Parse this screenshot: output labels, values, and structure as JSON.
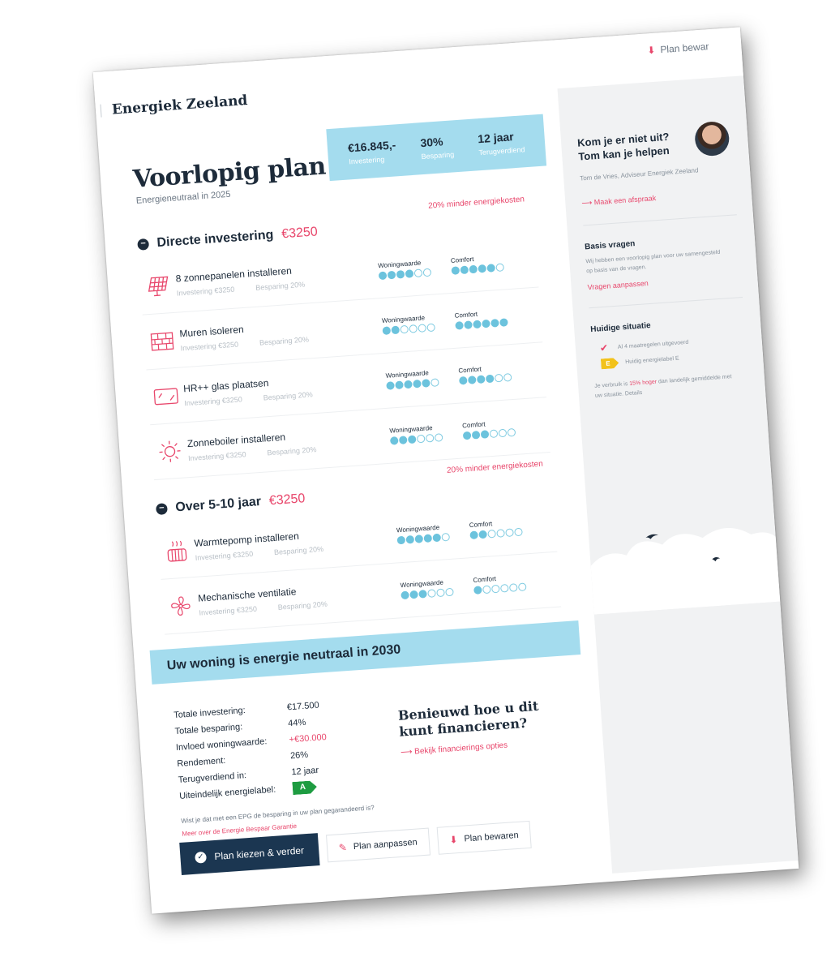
{
  "header": {
    "brand": "Energiek Zeeland",
    "save_label": "Plan bewar"
  },
  "hero": {
    "title": "Voorlopig plan",
    "subtitle": "Energieneutraal in 2025",
    "stats": [
      {
        "value": "€16.845,-",
        "label": "Investering"
      },
      {
        "value": "30%",
        "label": "Besparing"
      },
      {
        "value": "12 jaar",
        "label": "Terugverdiend"
      }
    ]
  },
  "sections": [
    {
      "note": "20% minder energiekosten",
      "title": "Directe investering",
      "amount": "€3250",
      "items": [
        {
          "name": "8 zonnepanelen installeren",
          "investment": "Investering €3250",
          "saving": "Besparing 20%",
          "icon": "solar-panel-icon",
          "woning": 4,
          "comfort": 5
        },
        {
          "name": "Muren isoleren",
          "investment": "Investering €3250",
          "saving": "Besparing 20%",
          "icon": "brick-wall-icon",
          "woning": 2,
          "comfort": 6
        },
        {
          "name": "HR++ glas plaatsen",
          "investment": "Investering €3250",
          "saving": "Besparing 20%",
          "icon": "glass-window-icon",
          "woning": 5,
          "comfort": 4
        },
        {
          "name": "Zonneboiler installeren",
          "investment": "Investering €3250",
          "saving": "Besparing 20%",
          "icon": "sun-icon",
          "woning": 3,
          "comfort": 3
        }
      ]
    },
    {
      "note": "20% minder energiekosten",
      "title": "Over 5-10 jaar",
      "amount": "€3250",
      "items": [
        {
          "name": "Warmtepomp installeren",
          "investment": "Investering €3250",
          "saving": "Besparing 20%",
          "icon": "heat-pump-icon",
          "woning": 5,
          "comfort": 2
        },
        {
          "name": "Mechanische ventilatie",
          "investment": "Investering €3250",
          "saving": "Besparing 20%",
          "icon": "fan-icon",
          "woning": 3,
          "comfort": 1
        }
      ]
    }
  ],
  "ratings": {
    "woning_label": "Woningwaarde",
    "comfort_label": "Comfort",
    "max_dots": 6
  },
  "neutral": {
    "banner": "Uw woning is energie neutraal in 2030",
    "rows": [
      {
        "key": "Totale investering:",
        "value": "€17.500"
      },
      {
        "key": "Totale besparing:",
        "value": "44%"
      },
      {
        "key": "Invloed woningwaarde:",
        "value": "+€30.000"
      },
      {
        "key": "Rendement:",
        "value": "26%"
      },
      {
        "key": "Terugverdiend in:",
        "value": "12 jaar"
      },
      {
        "key": "Uiteindelijk energielabel:",
        "value": "A"
      }
    ],
    "finance_title": "Benieuwd hoe u dit kunt financieren?",
    "finance_link": "Bekijk financierings opties",
    "epg_question": "Wist je dat met een EPG de besparing in uw plan gegarandeerd is?",
    "epg_link": "Meer over de Energie Bespaar Garantie"
  },
  "actions": {
    "primary": "Plan kiezen & verder",
    "edit": "Plan aanpassen",
    "save": "Plan bewaren"
  },
  "sidebar": {
    "advisor_question": "Kom je er niet uit? Tom kan je helpen",
    "advisor_name": "Tom de Vries, Adviseur Energiek Zeeland",
    "advisor_link": "Maak een afspraak",
    "basis_title": "Basis vragen",
    "basis_text": "Wij hebben een voorlopig plan voor uw samengesteld op basis van de vragen.",
    "basis_link": "Vragen aanpassen",
    "situation_title": "Huidige situatie",
    "situation_measures": "Al 4 maatregelen uitgevoerd",
    "situation_label_letter": "E",
    "situation_label": "Huidig energielabel E",
    "usage_prefix": "Je verbruik is ",
    "usage_highlight": "15% hoger",
    "usage_suffix": " dan landelijk gemiddelde met uw situatie. Details"
  },
  "colors": {
    "accent": "#e8466b",
    "navy": "#1b3651",
    "banner": "#a4dcee",
    "dot": "#6cc3dd"
  }
}
